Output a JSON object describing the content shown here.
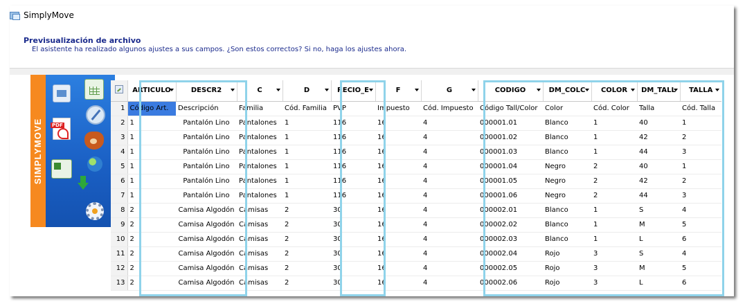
{
  "window": {
    "title": "SimplyMove"
  },
  "header": {
    "heading": "Previsualización de archivo",
    "subtitle": "El asistente ha realizado algunos ajustes a sus campos. ¿Son estos correctos? Si no, haga los ajustes ahora."
  },
  "sidebar": {
    "brand": "SIMPLYMOVE",
    "icons": [
      "word-document-icon",
      "spreadsheet-icon",
      "compass-icon",
      "pdf-icon",
      "firefox-icon",
      "excel-icon",
      "globe-icon",
      "green-arrow-icon",
      "gear-icon"
    ]
  },
  "grid": {
    "columns": [
      "ARTICULO",
      "DESCR2",
      "C",
      "D",
      "RECIO_E",
      "F",
      "G",
      "CODIGO",
      "DM_COLC",
      "COLOR",
      "DM_TALL",
      "TALLA"
    ],
    "subheaders": [
      "Código Art.",
      "Descripción",
      "Familia",
      "Cód. Familia",
      "PVP",
      "Impuesto",
      "Cód. Impuesto",
      "Código Tall/Color",
      "Color",
      "Cód. Color",
      "Talla",
      "Cód. Talla"
    ],
    "rows": [
      [
        "1",
        "Pantalón Lino",
        "Pantalones",
        "1",
        "116",
        "16",
        "4",
        "000001.01",
        "Blanco",
        "1",
        "40",
        "1"
      ],
      [
        "1",
        "Pantalón Lino",
        "Pantalones",
        "1",
        "116",
        "16",
        "4",
        "000001.02",
        "Blanco",
        "1",
        "42",
        "2"
      ],
      [
        "1",
        "Pantalón Lino",
        "Pantalones",
        "1",
        "116",
        "16",
        "4",
        "000001.03",
        "Blanco",
        "1",
        "44",
        "3"
      ],
      [
        "1",
        "Pantalón Lino",
        "Pantalones",
        "1",
        "116",
        "16",
        "4",
        "000001.04",
        "Negro",
        "2",
        "40",
        "1"
      ],
      [
        "1",
        "Pantalón Lino",
        "Pantalones",
        "1",
        "116",
        "16",
        "4",
        "000001.05",
        "Negro",
        "2",
        "42",
        "2"
      ],
      [
        "1",
        "Pantalón Lino",
        "Pantalones",
        "1",
        "116",
        "16",
        "4",
        "000001.06",
        "Negro",
        "2",
        "44",
        "3"
      ],
      [
        "2",
        "Camisa Algodón",
        "Camisas",
        "2",
        "30",
        "16",
        "4",
        "000002.01",
        "Blanco",
        "1",
        "S",
        "4"
      ],
      [
        "2",
        "Camisa Algodón",
        "Camisas",
        "2",
        "30",
        "16",
        "4",
        "000002.02",
        "Blanco",
        "1",
        "M",
        "5"
      ],
      [
        "2",
        "Camisa Algodón",
        "Camisas",
        "2",
        "30",
        "16",
        "4",
        "000002.03",
        "Blanco",
        "1",
        "L",
        "6"
      ],
      [
        "2",
        "Camisa Algodón",
        "Camisas",
        "2",
        "30",
        "16",
        "4",
        "000002.04",
        "Rojo",
        "3",
        "S",
        "4"
      ],
      [
        "2",
        "Camisa Algodón",
        "Camisas",
        "2",
        "30",
        "16",
        "4",
        "000002.05",
        "Rojo",
        "3",
        "M",
        "5"
      ],
      [
        "2",
        "Camisa Algodón",
        "Camisas",
        "2",
        "30",
        "16",
        "4",
        "000002.06",
        "Rojo",
        "3",
        "L",
        "6"
      ]
    ],
    "row_numbers": [
      "1",
      "2",
      "3",
      "4",
      "5",
      "6",
      "7",
      "8",
      "9",
      "10",
      "11",
      "12",
      "13"
    ]
  },
  "colors": {
    "brand_orange": "#f6891f",
    "panel_blue": "#1a5fc4",
    "highlight": "#8fd3ea",
    "selection": "#3a7be0",
    "heading_text": "#1a2a8c"
  }
}
